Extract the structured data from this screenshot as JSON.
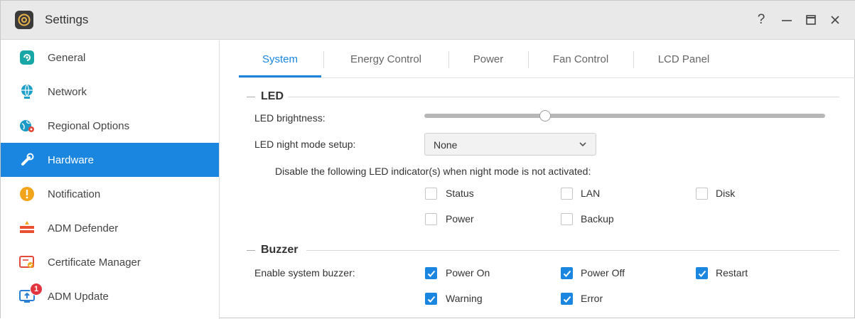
{
  "window": {
    "title": "Settings",
    "controls": {
      "help": "?",
      "minimize": "—",
      "maximize": "☐",
      "close": "✕"
    }
  },
  "sidebar": {
    "items": [
      {
        "label": "General",
        "icon": "general-icon",
        "color": "#19a6a6"
      },
      {
        "label": "Network",
        "icon": "globe-network-icon",
        "color": "#1aa0c8"
      },
      {
        "label": "Regional Options",
        "icon": "regional-globe-icon",
        "color": "#1e9ac9"
      },
      {
        "label": "Hardware",
        "icon": "wrench-icon",
        "color": "#ffffff",
        "active": true
      },
      {
        "label": "Notification",
        "icon": "alert-icon",
        "color": "#f2a51a"
      },
      {
        "label": "ADM Defender",
        "icon": "firewall-icon",
        "color": "#e8502f"
      },
      {
        "label": "Certificate Manager",
        "icon": "certificate-icon",
        "color": "#e24a3b"
      },
      {
        "label": "ADM Update",
        "icon": "update-icon",
        "color": "#2a7fd4",
        "badge": "1"
      }
    ]
  },
  "tabs": [
    {
      "label": "System",
      "active": true
    },
    {
      "label": "Energy Control"
    },
    {
      "label": "Power"
    },
    {
      "label": "Fan Control"
    },
    {
      "label": "LCD Panel"
    }
  ],
  "led": {
    "title": "LED",
    "brightness_label": "LED brightness:",
    "brightness_value": 0.29,
    "night_mode_label": "LED night mode setup:",
    "night_mode_value": "None",
    "disable_note": "Disable the following LED indicator(s) when night mode is not activated:",
    "indicators": [
      {
        "label": "Status",
        "checked": false
      },
      {
        "label": "LAN",
        "checked": false
      },
      {
        "label": "Disk",
        "checked": false
      },
      {
        "label": "Power",
        "checked": false
      },
      {
        "label": "Backup",
        "checked": false
      }
    ]
  },
  "buzzer": {
    "title": "Buzzer",
    "enable_label": "Enable system buzzer:",
    "options": [
      {
        "label": "Power On",
        "checked": true
      },
      {
        "label": "Power Off",
        "checked": true
      },
      {
        "label": "Restart",
        "checked": true
      },
      {
        "label": "Warning",
        "checked": true
      },
      {
        "label": "Error",
        "checked": true
      }
    ]
  },
  "colors": {
    "accent": "#1a86e0",
    "badge": "#e2343f"
  }
}
